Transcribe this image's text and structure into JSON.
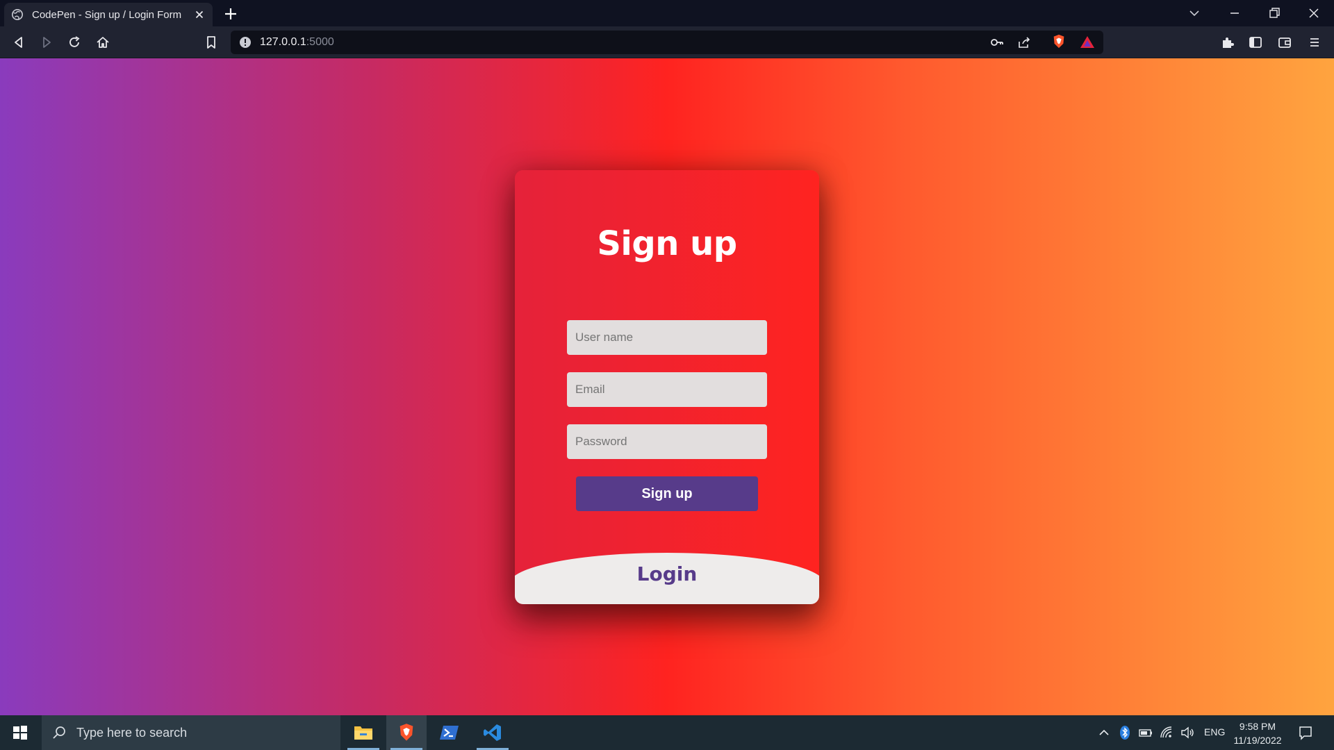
{
  "browser": {
    "tab_title": "CodePen - Sign up / Login Form",
    "url_host": "127.0.0.1",
    "url_port": ":5000"
  },
  "form": {
    "title": "Sign up",
    "fields": {
      "username_placeholder": "User name",
      "email_placeholder": "Email",
      "password_placeholder": "Password"
    },
    "signup_button": "Sign up",
    "login_label": "Login"
  },
  "colors": {
    "gradient_left": "#8a3bbd",
    "gradient_mid": "#ff2320",
    "gradient_right": "#ffa43f",
    "button_purple": "#573b8a",
    "login_panel": "#eeeceb"
  },
  "taskbar": {
    "search_placeholder": "Type here to search",
    "language": "ENG",
    "time": "9:58 PM",
    "date": "11/19/2022",
    "apps": [
      "file-explorer-icon",
      "brave-browser-icon",
      "powershell-icon",
      "vscode-icon"
    ]
  }
}
